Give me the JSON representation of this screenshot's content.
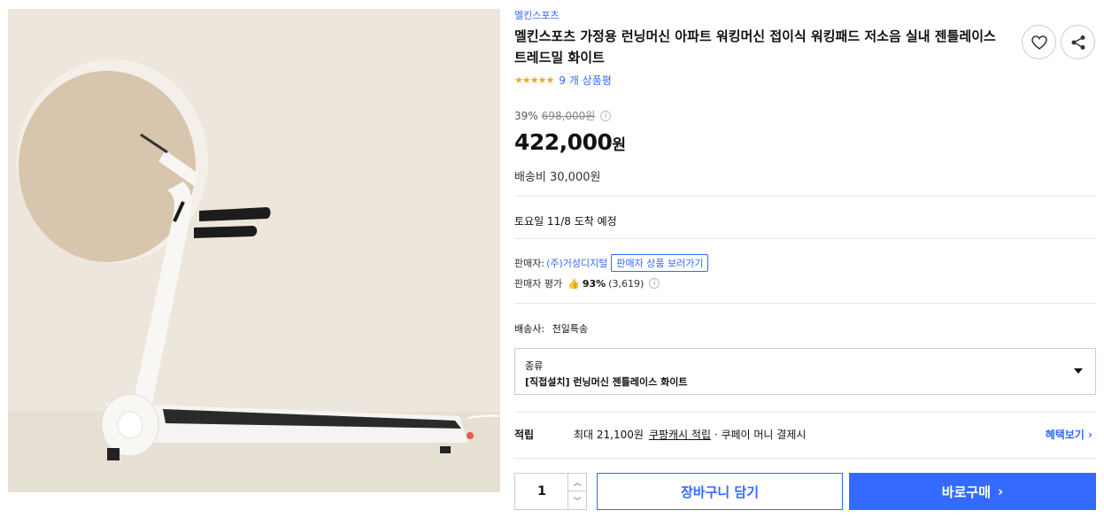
{
  "product": {
    "brand": "멜킨스포츠",
    "title": "멜킨스포츠 가정용 런닝머신 아파트 워킹머신 접이식 워킹패드 저소음 실내 젠틀레이스 트레드밀 화이트",
    "rating_stars": 5,
    "review_count": "9 개 상품평",
    "image_description": "white folding treadmill"
  },
  "price": {
    "discount": "39%",
    "original": "698,000원",
    "sale": "422,000",
    "unit": "원",
    "shipping_fee": "배송비 30,000원"
  },
  "delivery": {
    "arrival": "토요일 11/8 도착 예정",
    "courier_label": "배송사:",
    "courier": "천일특송"
  },
  "seller": {
    "label": "판매자:",
    "name": "(주)거성디지털",
    "view_products": "판매자 상품 보러가기",
    "rating_label": "판매자 평가",
    "rating_pct": "93%",
    "rating_count": "(3,619)"
  },
  "option": {
    "label": "종류",
    "value": "[직접설치] 런닝머신 젠틀레이스 화이트"
  },
  "points": {
    "label": "적립",
    "max": "최대 21,100원",
    "cash": "쿠팡캐시 적립",
    "extra": "· 쿠페이 머니 결제시",
    "link": "혜택보기"
  },
  "purchase": {
    "quantity": "1",
    "cart": "장바구니 담기",
    "buy": "바로구매"
  },
  "colors": {
    "accent": "#346aff",
    "star": "#f5a623",
    "image_bg": "#ece6dc"
  },
  "icons": [
    "heart-icon",
    "share-icon",
    "star-icon",
    "info-icon",
    "thumbs-up-icon",
    "caret-down-icon",
    "chevron-up-icon",
    "chevron-down-icon",
    "chevron-right-icon"
  ]
}
